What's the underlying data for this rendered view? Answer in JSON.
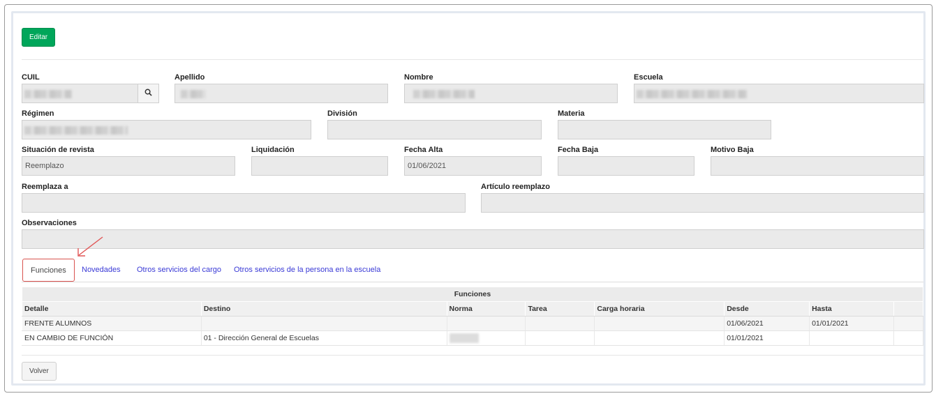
{
  "actions": {
    "edit_label": "Editar",
    "back_label": "Volver"
  },
  "form": {
    "cuil": {
      "label": "CUIL",
      "value": ""
    },
    "apellido": {
      "label": "Apellido",
      "value": ""
    },
    "nombre": {
      "label": "Nombre",
      "value": ""
    },
    "escuela": {
      "label": "Escuela",
      "value": ""
    },
    "regimen": {
      "label": "Régimen",
      "value": ""
    },
    "division": {
      "label": "División",
      "value": ""
    },
    "materia": {
      "label": "Materia",
      "value": ""
    },
    "situacion": {
      "label": "Situación de revista",
      "value": "Reemplazo"
    },
    "liquidacion": {
      "label": "Liquidación",
      "value": ""
    },
    "fecha_alta": {
      "label": "Fecha Alta",
      "value": "01/06/2021"
    },
    "fecha_baja": {
      "label": "Fecha Baja",
      "value": ""
    },
    "motivo_baja": {
      "label": "Motivo Baja",
      "value": ""
    },
    "reemplaza_a": {
      "label": "Reemplaza a",
      "value": ""
    },
    "articulo": {
      "label": "Artículo reemplazo",
      "value": ""
    },
    "observaciones": {
      "label": "Observaciones",
      "value": ""
    }
  },
  "tabs": [
    {
      "label": "Funciones",
      "active": true
    },
    {
      "label": "Novedades"
    },
    {
      "label": "Otros servicios del cargo"
    },
    {
      "label": "Otros servicios de la persona en la escuela"
    }
  ],
  "table": {
    "caption": "Funciones",
    "headers": [
      "Detalle",
      "Destino",
      "Norma",
      "Tarea",
      "Carga horaria",
      "Desde",
      "Hasta"
    ],
    "rows": [
      [
        "FRENTE ALUMNOS",
        "",
        "",
        "",
        "",
        "01/06/2021",
        "01/01/2021"
      ],
      [
        "EN CAMBIO DE FUNCIÓN",
        "01 - Dirección General de Escuelas",
        "",
        "",
        "",
        "01/01/2021",
        ""
      ]
    ]
  },
  "colors": {
    "edit_button": "#00a65a",
    "tab_link": "#3a3ad6",
    "active_tab_border": "#d9534f",
    "annotation_arrow": "#e05555"
  },
  "icons": {
    "search": "search-icon",
    "annotation": "arrow-annotation-icon"
  }
}
